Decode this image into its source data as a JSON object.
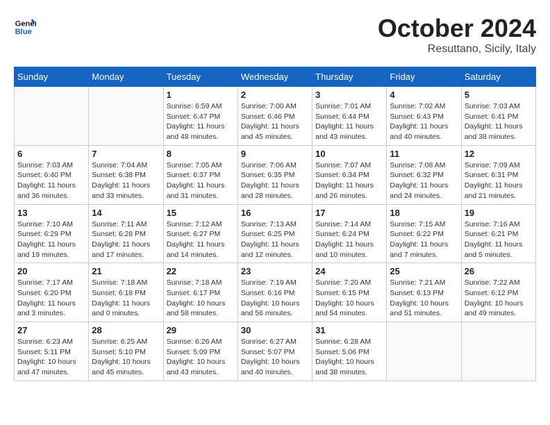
{
  "header": {
    "logo_line1": "General",
    "logo_line2": "Blue",
    "month_title": "October 2024",
    "subtitle": "Resuttano, Sicily, Italy"
  },
  "weekdays": [
    "Sunday",
    "Monday",
    "Tuesday",
    "Wednesday",
    "Thursday",
    "Friday",
    "Saturday"
  ],
  "weeks": [
    [
      {
        "day": "",
        "info": ""
      },
      {
        "day": "",
        "info": ""
      },
      {
        "day": "1",
        "info": "Sunrise: 6:59 AM\nSunset: 6:47 PM\nDaylight: 11 hours and 48 minutes."
      },
      {
        "day": "2",
        "info": "Sunrise: 7:00 AM\nSunset: 6:46 PM\nDaylight: 11 hours and 45 minutes."
      },
      {
        "day": "3",
        "info": "Sunrise: 7:01 AM\nSunset: 6:44 PM\nDaylight: 11 hours and 43 minutes."
      },
      {
        "day": "4",
        "info": "Sunrise: 7:02 AM\nSunset: 6:43 PM\nDaylight: 11 hours and 40 minutes."
      },
      {
        "day": "5",
        "info": "Sunrise: 7:03 AM\nSunset: 6:41 PM\nDaylight: 11 hours and 38 minutes."
      }
    ],
    [
      {
        "day": "6",
        "info": "Sunrise: 7:03 AM\nSunset: 6:40 PM\nDaylight: 11 hours and 36 minutes."
      },
      {
        "day": "7",
        "info": "Sunrise: 7:04 AM\nSunset: 6:38 PM\nDaylight: 11 hours and 33 minutes."
      },
      {
        "day": "8",
        "info": "Sunrise: 7:05 AM\nSunset: 6:37 PM\nDaylight: 11 hours and 31 minutes."
      },
      {
        "day": "9",
        "info": "Sunrise: 7:06 AM\nSunset: 6:35 PM\nDaylight: 11 hours and 28 minutes."
      },
      {
        "day": "10",
        "info": "Sunrise: 7:07 AM\nSunset: 6:34 PM\nDaylight: 11 hours and 26 minutes."
      },
      {
        "day": "11",
        "info": "Sunrise: 7:08 AM\nSunset: 6:32 PM\nDaylight: 11 hours and 24 minutes."
      },
      {
        "day": "12",
        "info": "Sunrise: 7:09 AM\nSunset: 6:31 PM\nDaylight: 11 hours and 21 minutes."
      }
    ],
    [
      {
        "day": "13",
        "info": "Sunrise: 7:10 AM\nSunset: 6:29 PM\nDaylight: 11 hours and 19 minutes."
      },
      {
        "day": "14",
        "info": "Sunrise: 7:11 AM\nSunset: 6:28 PM\nDaylight: 11 hours and 17 minutes."
      },
      {
        "day": "15",
        "info": "Sunrise: 7:12 AM\nSunset: 6:27 PM\nDaylight: 11 hours and 14 minutes."
      },
      {
        "day": "16",
        "info": "Sunrise: 7:13 AM\nSunset: 6:25 PM\nDaylight: 11 hours and 12 minutes."
      },
      {
        "day": "17",
        "info": "Sunrise: 7:14 AM\nSunset: 6:24 PM\nDaylight: 11 hours and 10 minutes."
      },
      {
        "day": "18",
        "info": "Sunrise: 7:15 AM\nSunset: 6:22 PM\nDaylight: 11 hours and 7 minutes."
      },
      {
        "day": "19",
        "info": "Sunrise: 7:16 AM\nSunset: 6:21 PM\nDaylight: 11 hours and 5 minutes."
      }
    ],
    [
      {
        "day": "20",
        "info": "Sunrise: 7:17 AM\nSunset: 6:20 PM\nDaylight: 11 hours and 3 minutes."
      },
      {
        "day": "21",
        "info": "Sunrise: 7:18 AM\nSunset: 6:18 PM\nDaylight: 11 hours and 0 minutes."
      },
      {
        "day": "22",
        "info": "Sunrise: 7:18 AM\nSunset: 6:17 PM\nDaylight: 10 hours and 58 minutes."
      },
      {
        "day": "23",
        "info": "Sunrise: 7:19 AM\nSunset: 6:16 PM\nDaylight: 10 hours and 56 minutes."
      },
      {
        "day": "24",
        "info": "Sunrise: 7:20 AM\nSunset: 6:15 PM\nDaylight: 10 hours and 54 minutes."
      },
      {
        "day": "25",
        "info": "Sunrise: 7:21 AM\nSunset: 6:13 PM\nDaylight: 10 hours and 51 minutes."
      },
      {
        "day": "26",
        "info": "Sunrise: 7:22 AM\nSunset: 6:12 PM\nDaylight: 10 hours and 49 minutes."
      }
    ],
    [
      {
        "day": "27",
        "info": "Sunrise: 6:23 AM\nSunset: 5:11 PM\nDaylight: 10 hours and 47 minutes."
      },
      {
        "day": "28",
        "info": "Sunrise: 6:25 AM\nSunset: 5:10 PM\nDaylight: 10 hours and 45 minutes."
      },
      {
        "day": "29",
        "info": "Sunrise: 6:26 AM\nSunset: 5:09 PM\nDaylight: 10 hours and 43 minutes."
      },
      {
        "day": "30",
        "info": "Sunrise: 6:27 AM\nSunset: 5:07 PM\nDaylight: 10 hours and 40 minutes."
      },
      {
        "day": "31",
        "info": "Sunrise: 6:28 AM\nSunset: 5:06 PM\nDaylight: 10 hours and 38 minutes."
      },
      {
        "day": "",
        "info": ""
      },
      {
        "day": "",
        "info": ""
      }
    ]
  ]
}
